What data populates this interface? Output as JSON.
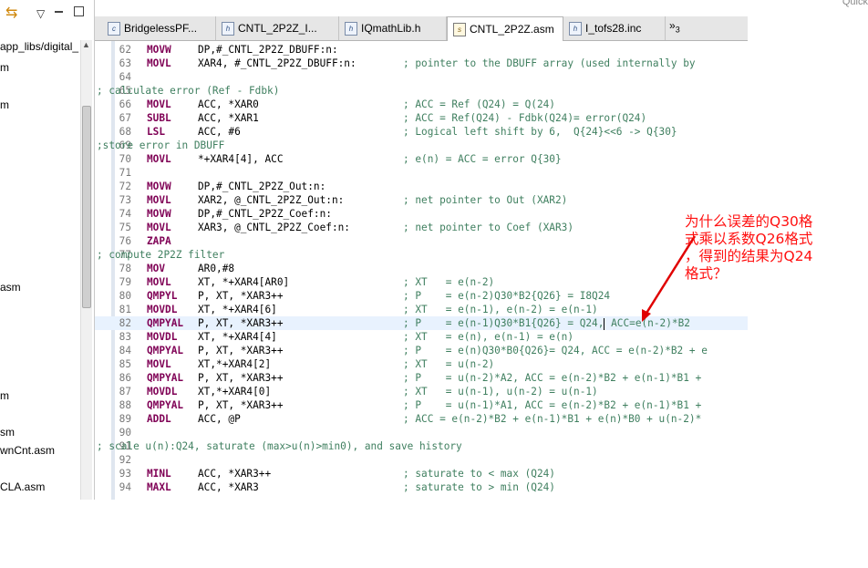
{
  "left_panel": {
    "toolbar": {
      "link_icon": "link-with-editor-icon",
      "view_menu_icon": "view-menu-chevron-icon"
    },
    "tree": [
      "app_libs/digital_",
      "m",
      "m",
      "asm",
      "m",
      "sm",
      "wnCnt.asm",
      "CLA.asm"
    ]
  },
  "editor": {
    "tabs": [
      {
        "label": "BridgelessPF...",
        "icon": "c"
      },
      {
        "label": "CNTL_2P2Z_I...",
        "icon": "h"
      },
      {
        "label": "IQmathLib.h",
        "icon": "h"
      },
      {
        "label": "CNTL_2P2Z.asm",
        "icon": "asm",
        "active": true
      },
      {
        "label": "I_tofs28.inc",
        "icon": "h"
      }
    ],
    "overflow_label": "»",
    "overflow_count": "3",
    "lines": [
      {
        "n": "62",
        "kw": "MOVW",
        "ops": "DP,#_CNTL_2P2Z_DBUFF:n:",
        "cmt": ""
      },
      {
        "n": "63",
        "kw": "MOVL",
        "ops": "XAR4, #_CNTL_2P2Z_DBUFF:n:",
        "cmt": "; pointer to the DBUFF array (used internally by"
      },
      {
        "n": "64",
        "kw": "",
        "ops": "",
        "cmt": ""
      },
      {
        "n": "65",
        "kw": "",
        "ops": "",
        "cmt": "; calculate error (Ref - Fdbk)",
        "full": true
      },
      {
        "n": "66",
        "kw": "MOVL",
        "ops": "ACC, *XAR0",
        "cmt": "; ACC = Ref (Q24) = Q(24)"
      },
      {
        "n": "67",
        "kw": "SUBL",
        "ops": "ACC, *XAR1",
        "cmt": "; ACC = Ref(Q24) - Fdbk(Q24)= error(Q24)"
      },
      {
        "n": "68",
        "kw": "LSL",
        "ops": "ACC, #6",
        "cmt": "; Logical left shift by 6,  Q{24}<<6 -> Q{30}"
      },
      {
        "n": "69",
        "kw": "",
        "ops": "",
        "cmt": ";store error in DBUFF",
        "full": true
      },
      {
        "n": "70",
        "kw": "MOVL",
        "ops": "*+XAR4[4], ACC",
        "cmt": "; e(n) = ACC = error Q{30}"
      },
      {
        "n": "71",
        "kw": "",
        "ops": "",
        "cmt": ""
      },
      {
        "n": "72",
        "kw": "MOVW",
        "ops": "DP,#_CNTL_2P2Z_Out:n:",
        "cmt": ""
      },
      {
        "n": "73",
        "kw": "MOVL",
        "ops": "XAR2, @_CNTL_2P2Z_Out:n:",
        "cmt": "; net pointer to Out (XAR2)"
      },
      {
        "n": "74",
        "kw": "MOVW",
        "ops": "DP,#_CNTL_2P2Z_Coef:n:",
        "cmt": ""
      },
      {
        "n": "75",
        "kw": "MOVL",
        "ops": "XAR3, @_CNTL_2P2Z_Coef:n:",
        "cmt": "; net pointer to Coef (XAR3)"
      },
      {
        "n": "76",
        "kw": "ZAPA",
        "ops": "",
        "cmt": ""
      },
      {
        "n": "77",
        "kw": "",
        "ops": "",
        "cmt": "; compute 2P2Z filter",
        "full": true
      },
      {
        "n": "78",
        "kw": "MOV",
        "ops": "AR0,#8",
        "cmt": ""
      },
      {
        "n": "79",
        "kw": "MOVL",
        "ops": "XT, *+XAR4[AR0]",
        "cmt": "; XT   = e(n-2)"
      },
      {
        "n": "80",
        "kw": "QMPYL",
        "ops": "P, XT, *XAR3++",
        "cmt": "; P    = e(n-2)Q30*B2{Q26} = I8Q24"
      },
      {
        "n": "81",
        "kw": "MOVDL",
        "ops": "XT, *+XAR4[6]",
        "cmt": "; XT   = e(n-1), e(n-2) = e(n-1)"
      },
      {
        "n": "82",
        "kw": "QMPYAL",
        "ops": "P, XT, *XAR3++",
        "cmt": "; P    = e(n-1)Q30*B1{Q26} = Q24,",
        "cmt2": " ACC=e(n-2)*B2",
        "cursor": true,
        "hl": true
      },
      {
        "n": "83",
        "kw": "MOVDL",
        "ops": "XT, *+XAR4[4]",
        "cmt": "; XT   = e(n), e(n-1) = e(n)"
      },
      {
        "n": "84",
        "kw": "QMPYAL",
        "ops": "P, XT, *XAR3++",
        "cmt": "; P    = e(n)Q30*B0{Q26}= Q24, ACC = e(n-2)*B2 + e"
      },
      {
        "n": "85",
        "kw": "MOVL",
        "ops": "XT,*+XAR4[2]",
        "cmt": "; XT   = u(n-2)"
      },
      {
        "n": "86",
        "kw": "QMPYAL",
        "ops": "P, XT, *XAR3++",
        "cmt": "; P    = u(n-2)*A2, ACC = e(n-2)*B2 + e(n-1)*B1 +"
      },
      {
        "n": "87",
        "kw": "MOVDL",
        "ops": "XT,*+XAR4[0]",
        "cmt": "; XT   = u(n-1), u(n-2) = u(n-1)"
      },
      {
        "n": "88",
        "kw": "QMPYAL",
        "ops": "P, XT, *XAR3++",
        "cmt": "; P    = u(n-1)*A1, ACC = e(n-2)*B2 + e(n-1)*B1 +"
      },
      {
        "n": "89",
        "kw": "ADDL",
        "ops": "ACC, @P",
        "cmt": "; ACC = e(n-2)*B2 + e(n-1)*B1 + e(n)*B0 + u(n-2)*"
      },
      {
        "n": "90",
        "kw": "",
        "ops": "",
        "cmt": ""
      },
      {
        "n": "91",
        "kw": "",
        "ops": "",
        "cmt": "; scale u(n):Q24, saturate (max>u(n)>min0), and save history",
        "full": true
      },
      {
        "n": "92",
        "kw": "",
        "ops": "",
        "cmt": ""
      },
      {
        "n": "93",
        "kw": "MINL",
        "ops": "ACC, *XAR3++",
        "cmt": "; saturate to < max (Q24)"
      },
      {
        "n": "94",
        "kw": "MAXL",
        "ops": "ACC, *XAR3",
        "cmt": "; saturate to > min (Q24)"
      }
    ]
  },
  "annotation": {
    "lines": [
      "为什么误差的Q30格",
      "式乘以系数Q26格式",
      "，得到的结果为Q24",
      "格式？"
    ],
    "color": "#ff1010"
  },
  "corner_text": "Quick",
  "colors": {
    "comment": "#3f7f5f",
    "keyword": "#7f0055",
    "highlight": "#e8f2fe"
  }
}
